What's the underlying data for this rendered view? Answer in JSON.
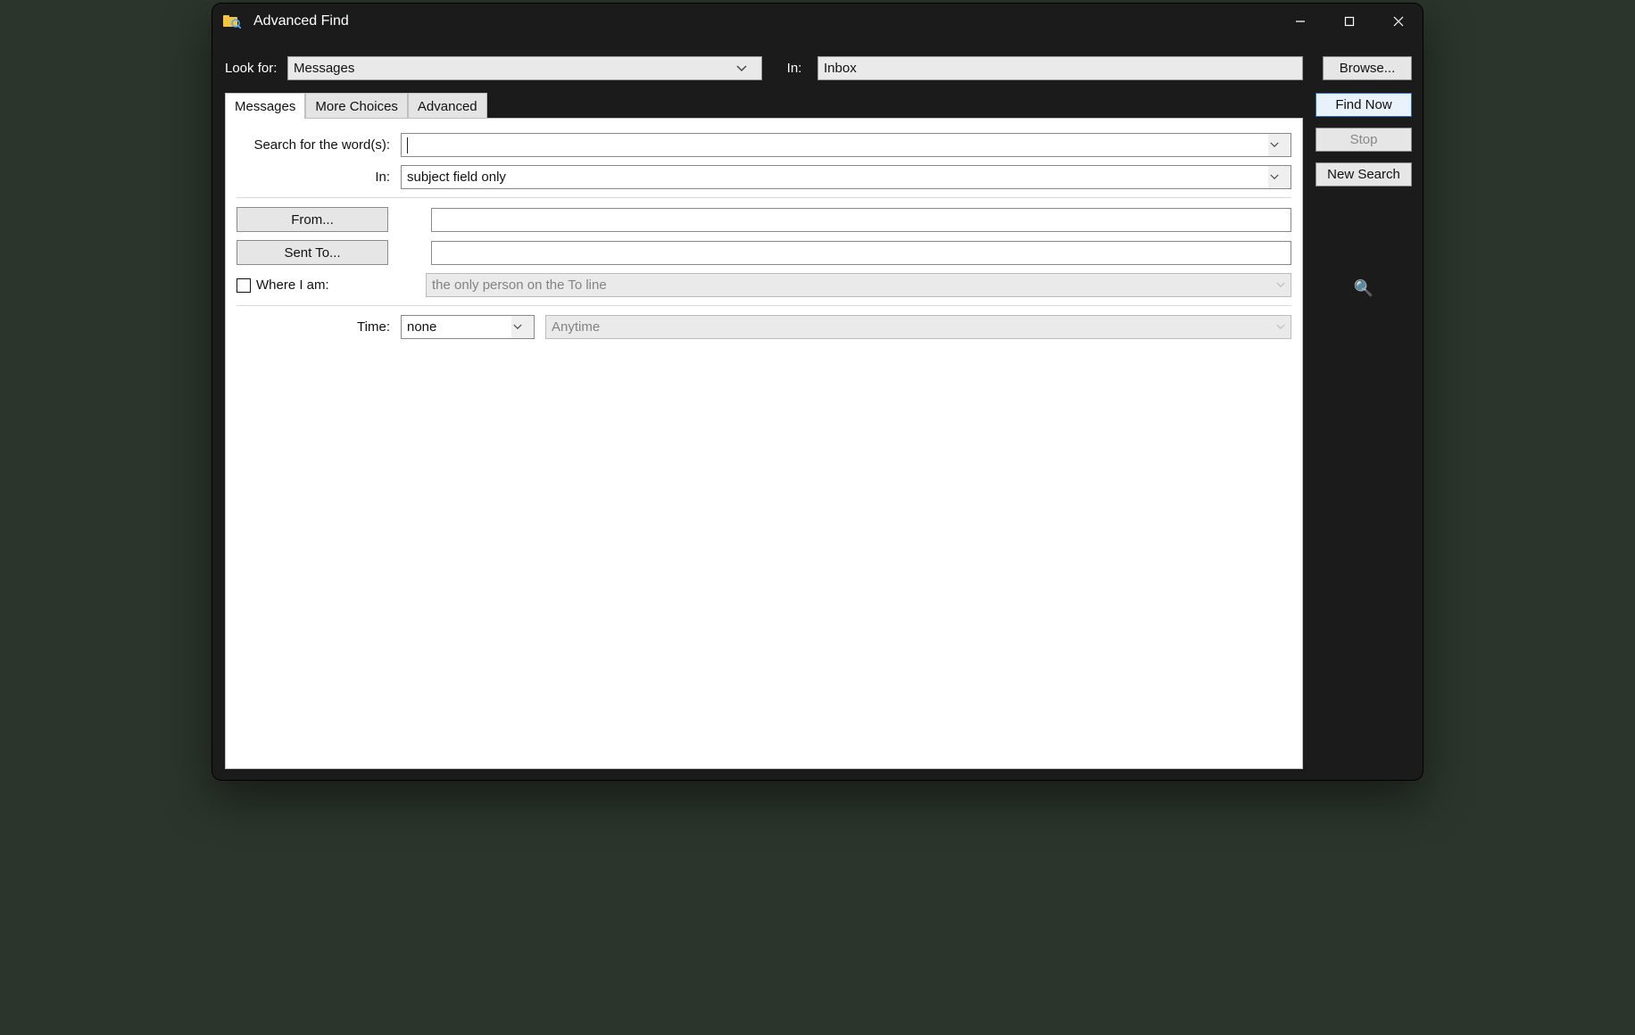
{
  "window": {
    "title": "Advanced Find"
  },
  "toolbar": {
    "look_for_label": "Look for:",
    "look_for_value": "Messages",
    "in_label": "In:",
    "in_value": "Inbox",
    "browse": "Browse..."
  },
  "tabs": {
    "messages": "Messages",
    "more_choices": "More Choices",
    "advanced": "Advanced"
  },
  "side": {
    "find_now": "Find Now",
    "stop": "Stop",
    "new_search": "New Search"
  },
  "form": {
    "search_words_label": "Search for the word(s):",
    "search_words_value": "",
    "in_label": "In:",
    "in_value": "subject field only",
    "from_btn": "From...",
    "from_value": "",
    "sentto_btn": "Sent To...",
    "sentto_value": "",
    "where_i_am_label": "Where I am:",
    "where_i_am_value": "the only person on the To line",
    "time_label": "Time:",
    "time_value": "none",
    "time_range_value": "Anytime"
  }
}
